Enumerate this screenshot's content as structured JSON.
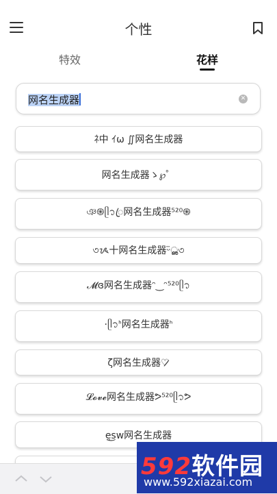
{
  "header": {
    "title": "个性"
  },
  "tabs": [
    {
      "label": "特效",
      "active": false
    },
    {
      "label": "花样",
      "active": true
    }
  ],
  "input": {
    "value": "网名生成器"
  },
  "results": [
    "ﾈ中 ｲω ∬网名生成器",
    "网名生成器ゝ℘゜",
    "ঞ֍ᥫ᭡ꦿ网名生成器⁵²⁰֍",
    "৩ᝰ十网名生成器ᵕ̈ൢ৩",
    "𝓜ɞ网名生成器ᵔ‿ᵔ⁵²⁰ᥫ᭡",
    "·ᥫ᭡ᑋ网名生成器ᑋ",
    "ζ网名生成器♡̷̷",
    "𝓛𝓸𝓿𝓮网名生成器ᕗ⁵²⁰ᥫ᭡ᕗ",
    "e̤͜sw网名生成器"
  ],
  "watermark": {
    "brand_num": "592",
    "brand_text": "软件园",
    "site": "www.592xiazai.com"
  },
  "colors": {
    "accent": "#3a6fd8",
    "watermark_bg": "#1f3aa8",
    "watermark_num": "#ff3a3a"
  }
}
